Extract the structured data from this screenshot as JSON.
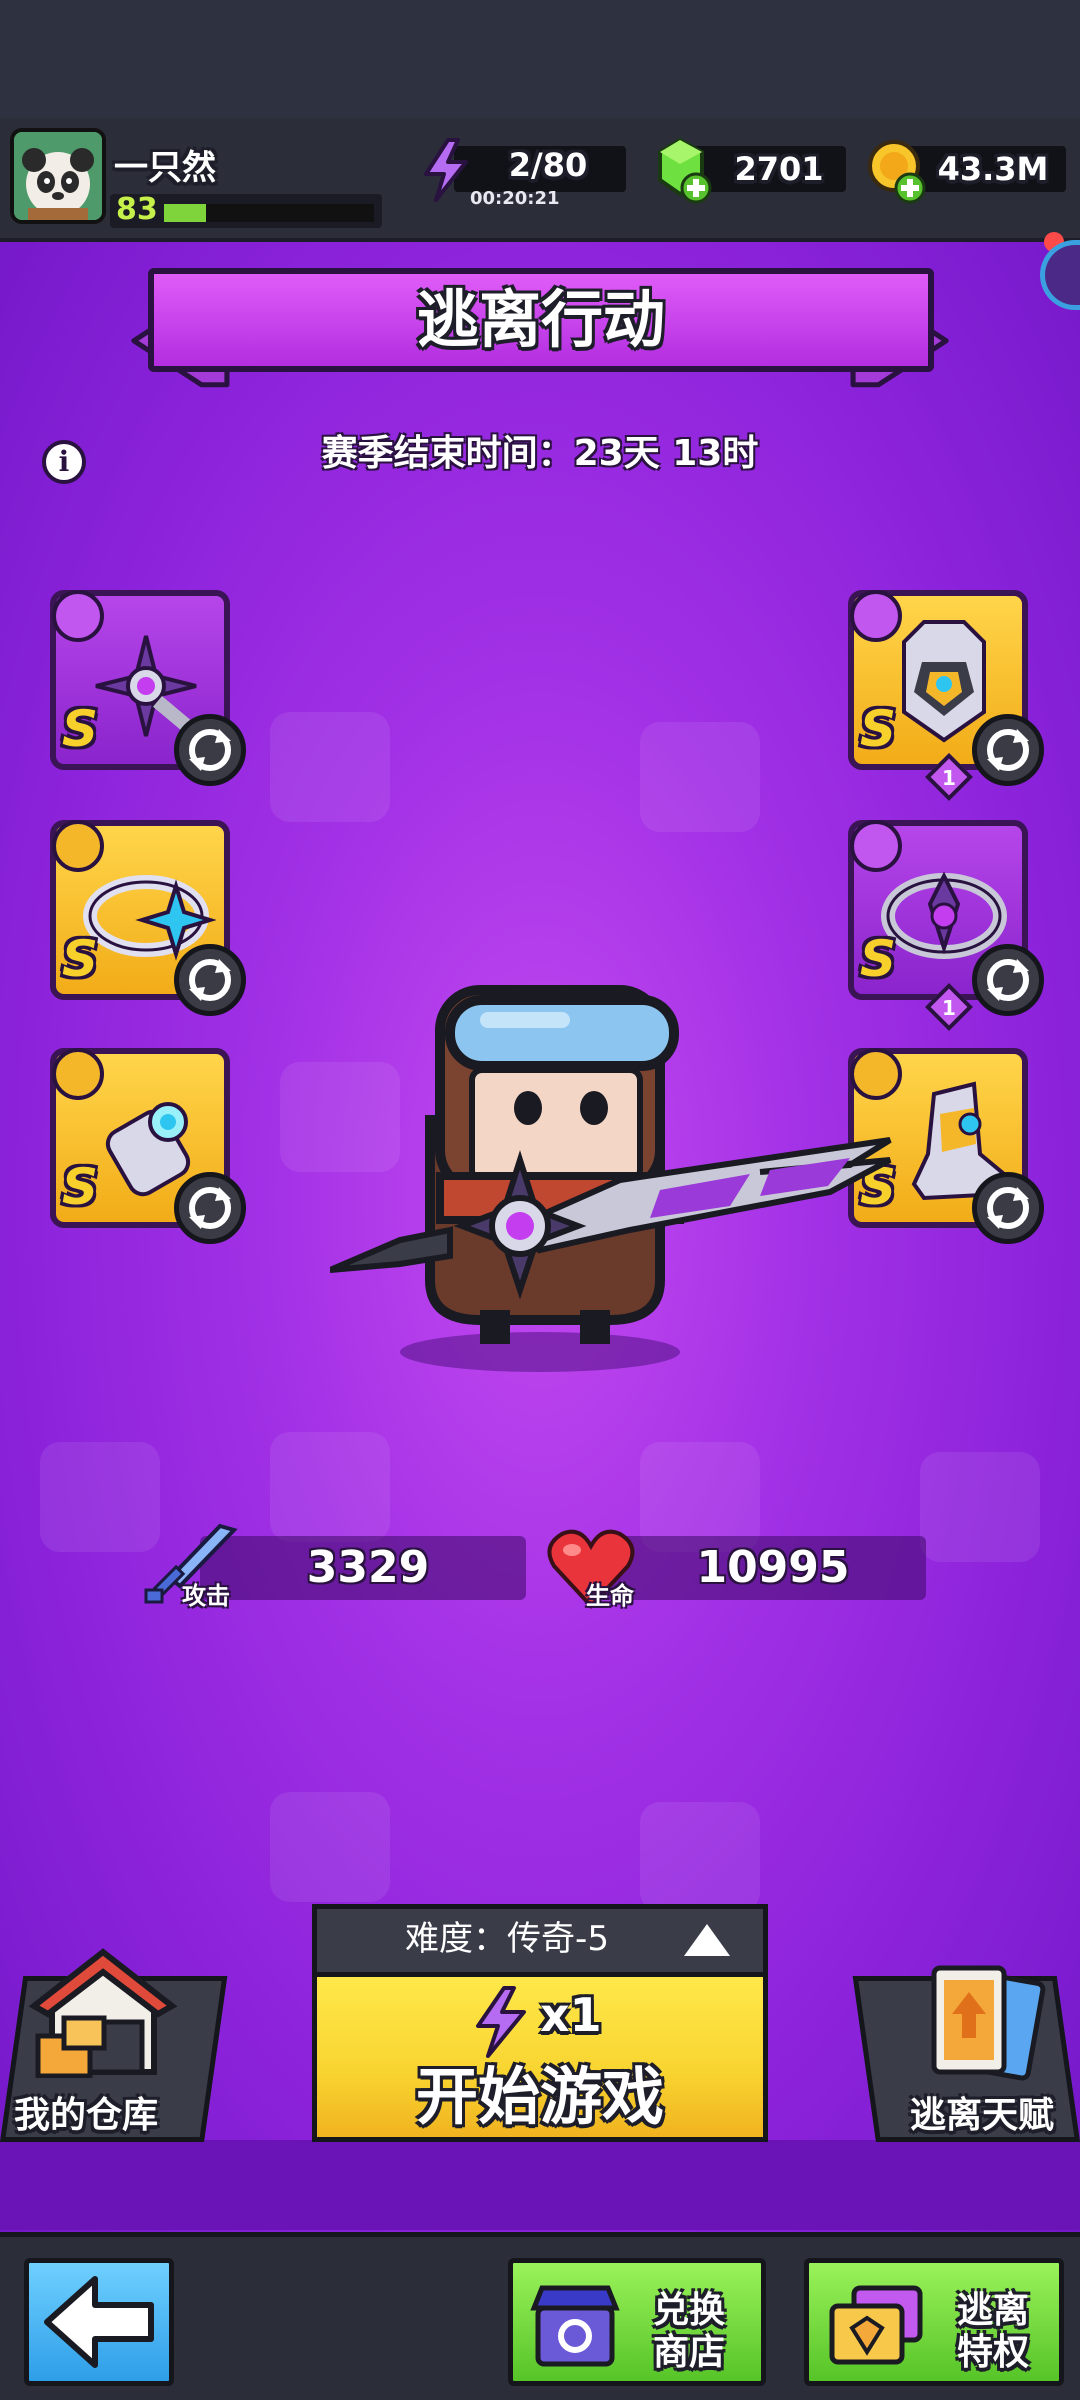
{
  "player": {
    "name": "一只然",
    "level": "83",
    "xp_fraction": 0.2
  },
  "resources": {
    "energy": "2/80",
    "energy_timer": "00:20:21",
    "gems": "2701",
    "gold": "43.3M"
  },
  "mode": {
    "title": "逃离行动",
    "season_end": "赛季结束时间：23天 13时"
  },
  "equipment": [
    {
      "rank": "S",
      "stars": ""
    },
    {
      "rank": "S",
      "stars": "1"
    },
    {
      "rank": "S",
      "stars": ""
    },
    {
      "rank": "S",
      "stars": "1"
    },
    {
      "rank": "S",
      "stars": ""
    },
    {
      "rank": "S",
      "stars": ""
    }
  ],
  "stats": {
    "attack_label": "攻击",
    "attack_value": "3329",
    "life_label": "生命",
    "life_value": "10995"
  },
  "game": {
    "difficulty": "难度：传奇-5",
    "energy_cost": "x1",
    "start_label": "开始游戏"
  },
  "side_buttons": {
    "warehouse": "我的仓库",
    "talent": "逃离天赋"
  },
  "bottom_nav": {
    "exchange_line1": "兑换",
    "exchange_line2": "商店",
    "privilege_line1": "逃离",
    "privilege_line2": "特权"
  },
  "colors": {
    "purple_main": "#a331e6",
    "gold_slot": "#f2ac18",
    "start_yellow": "#f8d430",
    "nav_green": "#56c428",
    "back_blue": "#2e9ee8"
  }
}
